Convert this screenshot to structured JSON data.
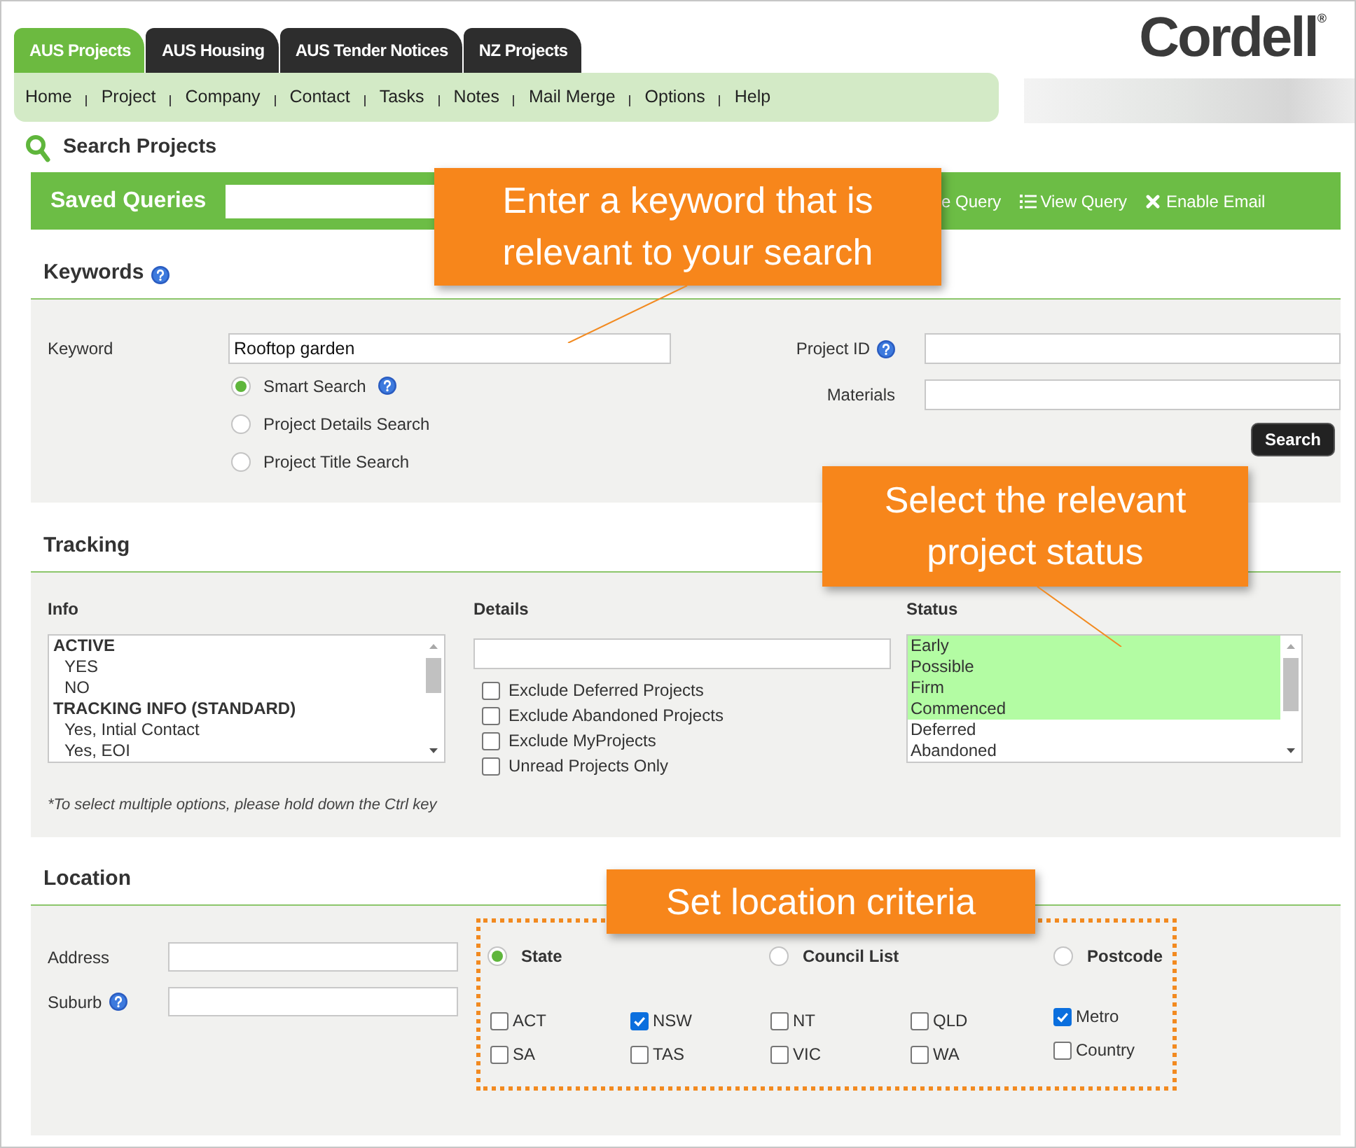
{
  "tabs": [
    {
      "label": "AUS Projects",
      "selected": true
    },
    {
      "label": "AUS Housing",
      "selected": false
    },
    {
      "label": "AUS Tender Notices",
      "selected": false
    },
    {
      "label": "NZ Projects",
      "selected": false
    }
  ],
  "logo": "Cordell$^{®}$",
  "nav": [
    "Home",
    "Project",
    "Company",
    "Contact",
    "Tasks",
    "Notes",
    "Mail Merge",
    "Options",
    "Help"
  ],
  "page_title": "Search Projects",
  "saved_queries": {
    "label": "Saved Queries",
    "partial_action": "e Query",
    "view_query": "View Query",
    "enable_email": "Enable Email"
  },
  "keywords": {
    "heading": "Keywords",
    "keyword": {
      "label": "Keyword",
      "value": "Rooftop garden"
    },
    "search_modes": [
      {
        "label": "Smart Search",
        "selected": true,
        "help": true
      },
      {
        "label": "Project Details Search",
        "selected": false,
        "help": false
      },
      {
        "label": "Project Title Search",
        "selected": false,
        "help": false
      }
    ],
    "project_id": {
      "label": "Project ID"
    },
    "materials": {
      "label": "Materials"
    },
    "search_button": "Search"
  },
  "tracking": {
    "heading": "Tracking",
    "info": {
      "label": "Info",
      "groups": [
        {
          "label": "ACTIVE",
          "children": [
            {
              "label": "YES",
              "selected": false
            },
            {
              "label": "NO",
              "selected": false
            }
          ]
        },
        {
          "label": "TRACKING INFO (STANDARD)",
          "children": [
            {
              "label": "Yes, Intial Contact",
              "selected": false
            },
            {
              "label": "Yes, EOI",
              "selected": false
            }
          ]
        }
      ]
    },
    "details": {
      "label": "Details",
      "options": [
        {
          "label": "Exclude Deferred Projects",
          "checked": false
        },
        {
          "label": "Exclude Abandoned Projects",
          "checked": false
        },
        {
          "label": "Exclude MyProjects",
          "checked": false
        },
        {
          "label": "Unread Projects Only",
          "checked": false
        }
      ]
    },
    "status": {
      "label": "Status",
      "options": [
        {
          "label": "Early",
          "selected": true
        },
        {
          "label": "Possible",
          "selected": true
        },
        {
          "label": "Firm",
          "selected": true
        },
        {
          "label": "Commenced",
          "selected": true
        },
        {
          "label": "Deferred",
          "selected": false
        },
        {
          "label": "Abandoned",
          "selected": false
        }
      ]
    },
    "note": "*To select multiple options, please hold down the Ctrl key"
  },
  "location": {
    "heading": "Location",
    "address": {
      "label": "Address"
    },
    "suburb": {
      "label": "Suburb"
    },
    "modes": [
      {
        "label": "State",
        "selected": true
      },
      {
        "label": "Council List",
        "selected": false
      },
      {
        "label": "Postcode",
        "selected": false
      }
    ],
    "states": [
      {
        "label": "ACT",
        "checked": false
      },
      {
        "label": "NSW",
        "checked": true
      },
      {
        "label": "NT",
        "checked": false
      },
      {
        "label": "QLD",
        "checked": false
      },
      {
        "label": "SA",
        "checked": false
      },
      {
        "label": "TAS",
        "checked": false
      },
      {
        "label": "VIC",
        "checked": false
      },
      {
        "label": "WA",
        "checked": false
      }
    ],
    "areas": [
      {
        "label": "Metro",
        "checked": true
      },
      {
        "label": "Country",
        "checked": false
      }
    ]
  },
  "callouts": [
    {
      "text": "Enter a keyword that is relevant to your search"
    },
    {
      "text": "Select the relevant project status"
    },
    {
      "text": "Set location criteria"
    }
  ]
}
